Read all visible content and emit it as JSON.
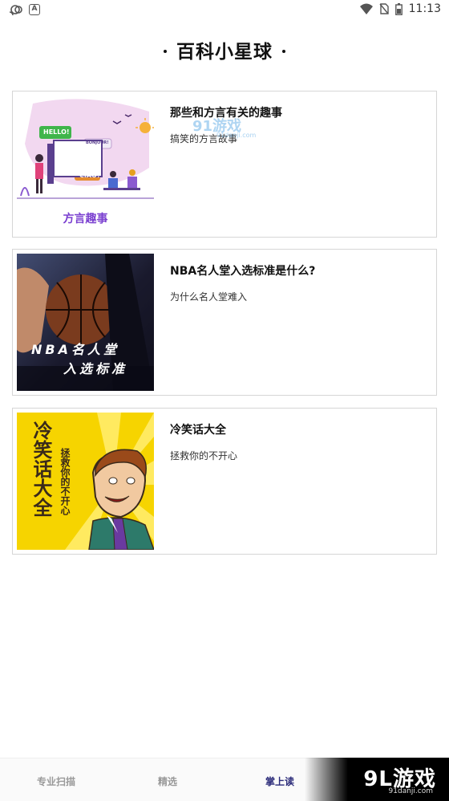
{
  "status_bar": {
    "time": "11:13",
    "left_icons": [
      "cast-icon",
      "text-notification-icon"
    ],
    "right_icons": [
      "wifi-icon",
      "no-sim-icon",
      "battery-icon"
    ]
  },
  "header": {
    "title": "百科小星球"
  },
  "cards": [
    {
      "title": "那些和方言有关的趣事",
      "description": "搞笑的方言故事",
      "thumb": {
        "caption": "方言趣事",
        "bubbles": [
          "HELLO!",
          "BONJOUR!",
          "こんにちは",
          "CIAO!"
        ]
      }
    },
    {
      "title": "NBA名人堂入选标准是什么?",
      "description": "为什么名人堂难入",
      "thumb": {
        "line1": "NBA名人堂",
        "line2": "入选标准"
      }
    },
    {
      "title": "冷笑话大全",
      "description": "拯救你的不开心",
      "thumb": {
        "title": "冷笑话大全",
        "subtitle": "拯救你的不开心"
      }
    }
  ],
  "watermark": {
    "text": "91游戏",
    "url": "91danji.com"
  },
  "bottom_nav": {
    "items": [
      {
        "label": "专业扫描",
        "active": false
      },
      {
        "label": "精选",
        "active": false
      },
      {
        "label": "掌上读",
        "active": true
      }
    ]
  },
  "brand_badge": {
    "text": "9L游戏",
    "url": "91danji.com"
  },
  "colors": {
    "accent": "#2c2c7a",
    "card_border": "#d6d6d6",
    "dialect_caption": "#7a3fd0",
    "joke_bg": "#f6d400"
  }
}
